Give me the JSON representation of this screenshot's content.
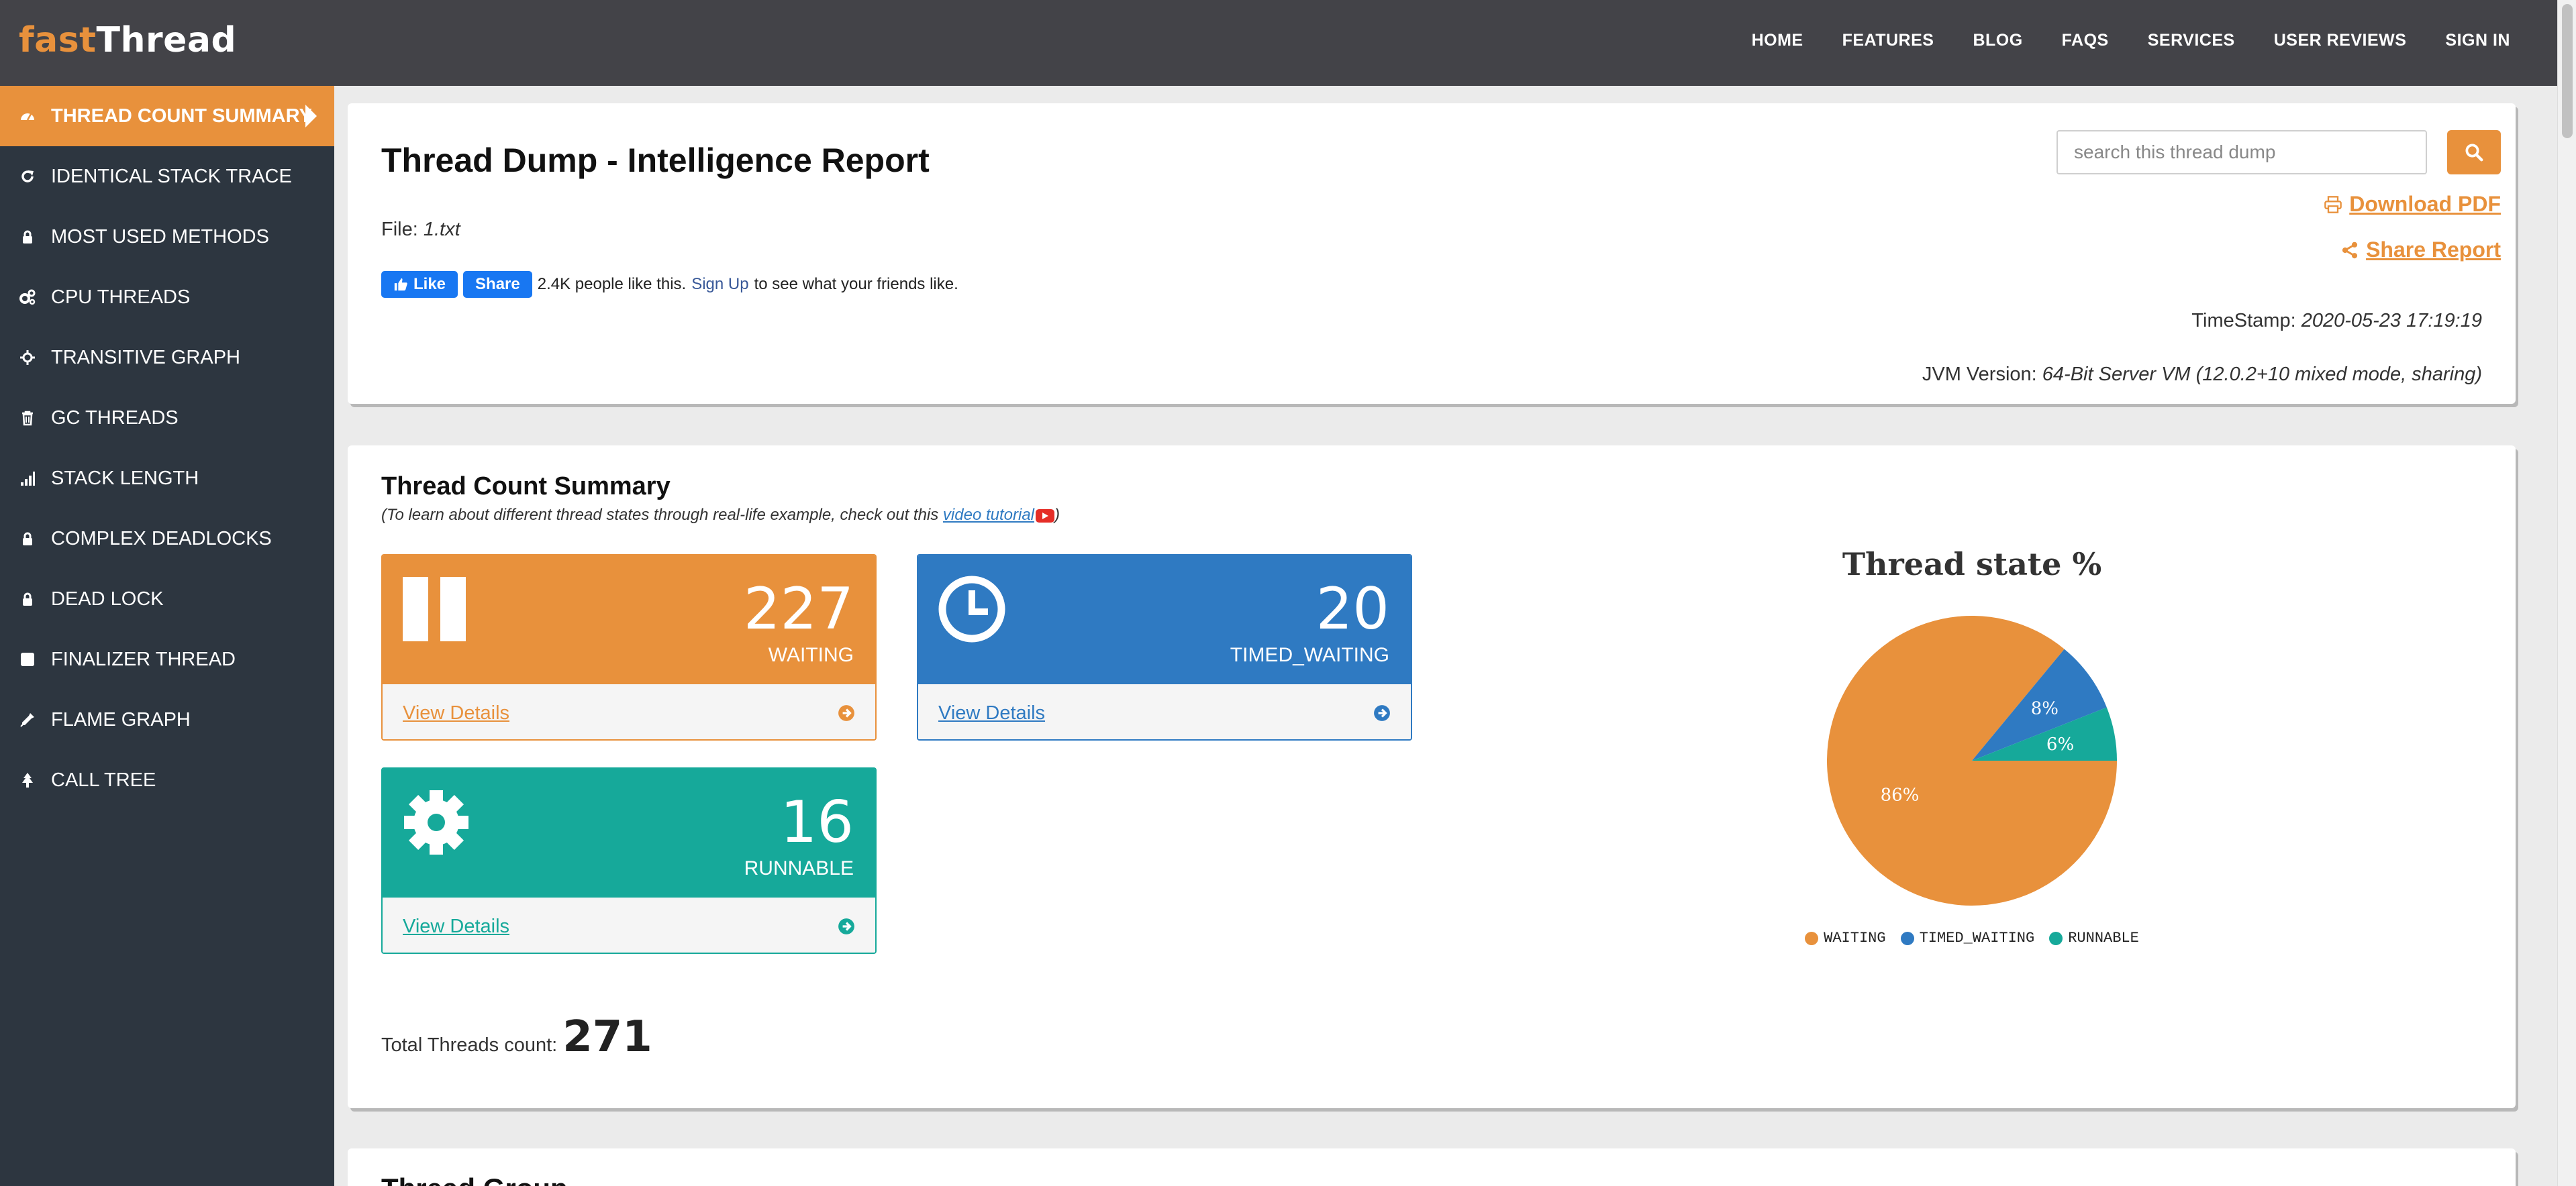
{
  "brand": {
    "part1": "fast",
    "part2": "Thread"
  },
  "topnav": [
    "HOME",
    "FEATURES",
    "BLOG",
    "FAQS",
    "SERVICES",
    "USER REVIEWS",
    "SIGN IN"
  ],
  "sidebar": {
    "items": [
      {
        "label": "THREAD COUNT SUMMARY",
        "icon": "dashboard-icon",
        "active": true
      },
      {
        "label": "IDENTICAL STACK TRACE",
        "icon": "refresh-icon"
      },
      {
        "label": "MOST USED METHODS",
        "icon": "lock-icon"
      },
      {
        "label": "CPU THREADS",
        "icon": "cogs-icon"
      },
      {
        "label": "TRANSITIVE GRAPH",
        "icon": "crosshairs-icon"
      },
      {
        "label": "GC THREADS",
        "icon": "trash-icon"
      },
      {
        "label": "STACK LENGTH",
        "icon": "signal-icon"
      },
      {
        "label": "COMPLEX DEADLOCKS",
        "icon": "lock-icon"
      },
      {
        "label": "DEAD LOCK",
        "icon": "lock-icon"
      },
      {
        "label": "FINALIZER THREAD",
        "icon": "square-icon"
      },
      {
        "label": "FLAME GRAPH",
        "icon": "eyedropper-icon"
      },
      {
        "label": "CALL TREE",
        "icon": "tree-icon"
      }
    ]
  },
  "report": {
    "title": "Thread Dump - Intelligence Report",
    "file_label": "File:",
    "file_name": "1.txt",
    "search_placeholder": "search this thread dump",
    "download_pdf": "Download PDF",
    "share_report": "Share Report",
    "timestamp_label": "TimeStamp:",
    "timestamp_value": "2020-05-23 17:19:19",
    "jvm_label": "JVM Version:",
    "jvm_value": "64-Bit Server VM (12.0.2+10 mixed mode, sharing)"
  },
  "facebook": {
    "like": "Like",
    "share": "Share",
    "count_text": "2.4K people like this.",
    "signup": "Sign Up",
    "suffix": "to see what your friends like."
  },
  "summary": {
    "title": "Thread Count Summary",
    "subtitle_prefix": "(To learn about different thread states through real-life example, check out this ",
    "subtitle_link": "video tutorial",
    "subtitle_suffix": ")",
    "view_details": "View Details",
    "panels": [
      {
        "count": "227",
        "state": "WAITING",
        "color": "#e8913c",
        "icon": "pause-icon"
      },
      {
        "count": "20",
        "state": "TIMED_WAITING",
        "color": "#2f7ac2",
        "icon": "clock-icon"
      },
      {
        "count": "16",
        "state": "RUNNABLE",
        "color": "#16a99a",
        "icon": "gear-icon"
      }
    ],
    "total_label": "Total Threads count:",
    "total_value": "271"
  },
  "chart_data": {
    "type": "pie",
    "title": "Thread state %",
    "categories": [
      "WAITING",
      "TIMED_WAITING",
      "RUNNABLE"
    ],
    "values": [
      86,
      8,
      6
    ],
    "labels": [
      "86%",
      "8%",
      "6%"
    ],
    "colors": [
      "#e8913c",
      "#2f7ac2",
      "#16a99a"
    ],
    "legend": "bottom"
  },
  "thread_group": {
    "title": "Thread Group"
  }
}
